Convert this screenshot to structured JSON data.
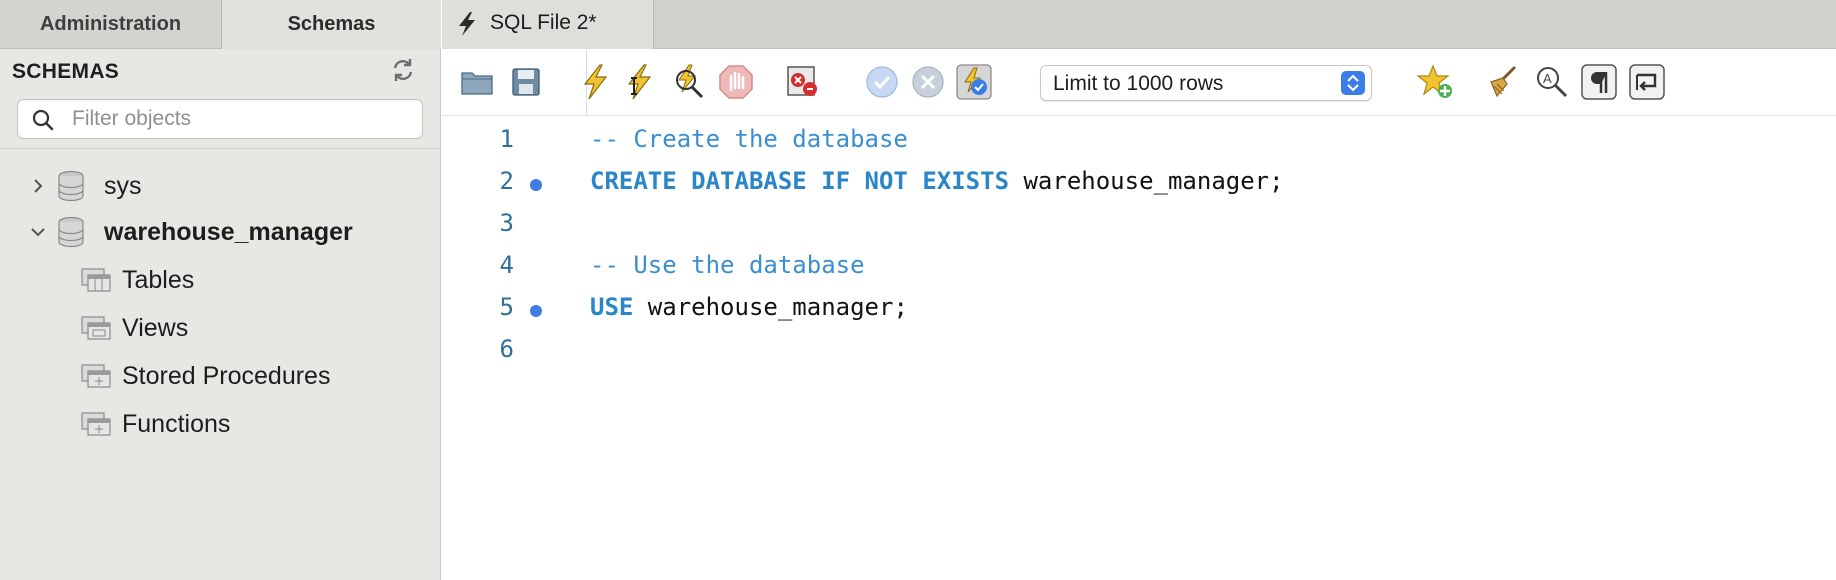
{
  "left_tabs": {
    "administration": "Administration",
    "schemas": "Schemas"
  },
  "schemas_panel": {
    "header": "SCHEMAS",
    "filter_placeholder": "Filter objects",
    "tree": {
      "sys": {
        "label": "sys",
        "expanded": false
      },
      "warehouse_manager": {
        "label": "warehouse_manager",
        "expanded": true,
        "children": [
          "Tables",
          "Views",
          "Stored Procedures",
          "Functions"
        ]
      }
    }
  },
  "editor_tab": {
    "label": "SQL File 2*"
  },
  "toolbar": {
    "limit_select_value": "Limit to 1000 rows",
    "icons": [
      "open-folder-icon",
      "save-icon",
      "execute-icon",
      "execute-current-icon",
      "explain-icon",
      "stop-icon",
      "toggle-error-icon",
      "commit-icon",
      "rollback-icon",
      "autocommit-icon",
      "add-snippet-icon",
      "beautify-icon",
      "find-icon",
      "invisibles-icon",
      "wrap-icon"
    ]
  },
  "editor": {
    "lines": [
      {
        "number": "1",
        "breakpoint": false,
        "tokens": [
          {
            "type": "comment",
            "text": "-- Create the database"
          }
        ]
      },
      {
        "number": "2",
        "breakpoint": true,
        "tokens": [
          {
            "type": "keyword",
            "text": "CREATE DATABASE IF NOT EXISTS"
          },
          {
            "type": "plain",
            "text": " warehouse_manager;"
          }
        ]
      },
      {
        "number": "3",
        "breakpoint": false,
        "tokens": []
      },
      {
        "number": "4",
        "breakpoint": false,
        "tokens": [
          {
            "type": "comment",
            "text": "-- Use the database"
          }
        ]
      },
      {
        "number": "5",
        "breakpoint": true,
        "tokens": [
          {
            "type": "keyword",
            "text": "USE"
          },
          {
            "type": "plain",
            "text": " warehouse_manager;"
          }
        ]
      },
      {
        "number": "6",
        "breakpoint": false,
        "tokens": []
      }
    ]
  },
  "colors": {
    "keyword": "#2a86c7",
    "comment": "#3b8fd1",
    "line_number": "#2f6f9a",
    "breakpoint": "#3d7ee0",
    "sidebar_bg": "#e7e7e4"
  }
}
